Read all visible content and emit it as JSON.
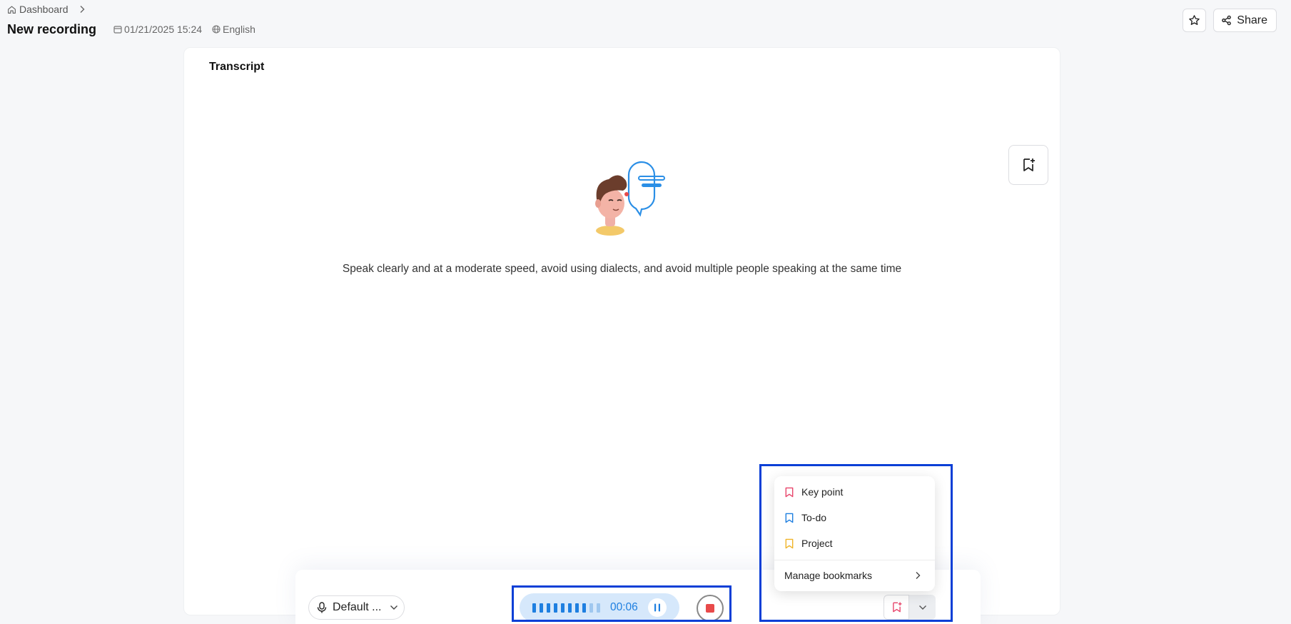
{
  "breadcrumb": {
    "home_label": "Dashboard"
  },
  "header": {
    "title": "New recording",
    "date": "01/21/2025 15:24",
    "language": "English",
    "share_label": "Share"
  },
  "transcript": {
    "title": "Transcript",
    "hint": "Speak clearly and at a moderate speed, avoid using dialects, and avoid multiple people speaking at the same time"
  },
  "controls": {
    "mic_label": "Default ...",
    "timer": "00:06"
  },
  "bookmark_menu": {
    "items": [
      {
        "label": "Key point",
        "color": "#e8456b"
      },
      {
        "label": "To-do",
        "color": "#1e7fe0"
      },
      {
        "label": "Project",
        "color": "#f0b429"
      }
    ],
    "manage_label": "Manage bookmarks"
  },
  "colors": {
    "accent": "#1e7fe0",
    "highlight": "#0a3fd6",
    "stop": "#e84a4a"
  }
}
